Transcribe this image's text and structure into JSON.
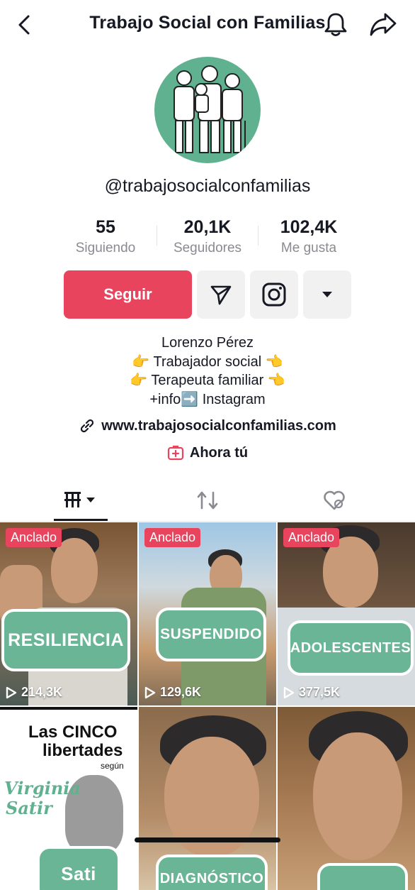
{
  "header": {
    "title": "Trabajo Social con Familias"
  },
  "profile": {
    "username": "@trabajosocialconfamilias",
    "stats": [
      {
        "value": "55",
        "label": "Siguiendo"
      },
      {
        "value": "20,1K",
        "label": "Seguidores"
      },
      {
        "value": "102,4K",
        "label": "Me gusta"
      }
    ],
    "follow_label": "Seguir",
    "bio": [
      "Lorenzo Pérez",
      "👉 Trabajador social 👈",
      "👉 Terapeuta familiar 👈",
      "+info➡️ Instagram"
    ],
    "link": "www.trabajosocialconfamilias.com",
    "ahora": "Ahora tú"
  },
  "videos": [
    {
      "pinned": "Anclado",
      "caption": "RESILIENCIA",
      "views": "214,3K"
    },
    {
      "pinned": "Anclado",
      "caption": "SUSPENDIDO",
      "views": "129,6K"
    },
    {
      "pinned": "Anclado",
      "caption": "ADOLESCENTES",
      "views": "377,5K"
    },
    {
      "title_line1": "Las CINCO",
      "title_line2": "libertades",
      "title_line3": "según",
      "script_line1": "Virginia",
      "script_line2": "Satir",
      "caption": "Sati"
    },
    {
      "caption": "DIAGNÓSTICO"
    },
    {
      "caption": ""
    }
  ],
  "colors": {
    "accent": "#e8445e",
    "avatar_bg": "#5fb18f",
    "bubble": "#6bb597"
  }
}
